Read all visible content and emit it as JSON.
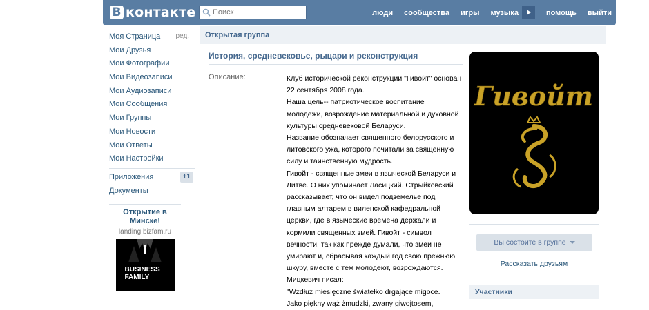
{
  "header": {
    "logo_letter": "В",
    "logo_text": "контакте",
    "search_placeholder": "Поиск",
    "nav": [
      "люди",
      "сообщества",
      "игры",
      "музыка",
      "помощь",
      "выйти"
    ]
  },
  "sidebar": {
    "items": [
      {
        "label": "Моя Страница",
        "extra": "ред."
      },
      {
        "label": "Мои Друзья"
      },
      {
        "label": "Мои Фотографии"
      },
      {
        "label": "Мои Видеозаписи"
      },
      {
        "label": "Мои Аудиозаписи"
      },
      {
        "label": "Мои Сообщения"
      },
      {
        "label": "Мои Группы"
      },
      {
        "label": "Мои Новости"
      },
      {
        "label": "Мои Ответы"
      },
      {
        "label": "Мои Настройки"
      }
    ],
    "apps_label": "Приложения",
    "apps_badge": "+1",
    "docs_label": "Документы"
  },
  "ad": {
    "title_line1": "Открытие в",
    "title_line2": "Минске!",
    "url": "landing.bizfam.ru",
    "image_line1": "BUSINESS",
    "image_line2": "FAMILY"
  },
  "group": {
    "type": "Открытая группа",
    "title": "История, средневековье, рыцари и реконструкция",
    "description_label": "Описание:",
    "description_lines": [
      "Клуб исторической реконструкции \"Гивойт\" основан",
      "22 сентября 2008 года.",
      "Наша цель-- патриотическое воспитание",
      "молодёжи, возрождение материальной и духовной",
      "культуры средневековой Беларуси.",
      "Название обозначает священного белорусского и",
      "литовского ужа, которого почитали за священную",
      "силу и таинственную мудрость.",
      "Гивойт - священные змеи в языческой Беларуси и",
      "Литве. О них упоминает Ласицкий. Стрыйковский",
      "рассказывает, что он видел подземелье под",
      "главным алтарем в виленской кафедральной",
      "церкви, где в языческие времена держали и",
      "кормили священных змей. Гивойт - символ",
      "вечности, так как прежде думали, что змеи не",
      "умирают и, сбрасывая каждый год свою прежнюю",
      "шкуру, вместе с тем молодеют, возрождаются.",
      "Мицкевич писал:",
      "\"Wzdłuż miesięczne światełko drgające migoce.",
      "Jako piękny wąż żmudzki, zwany giwojtosem,"
    ],
    "avatar_text": "Гивойт",
    "member_button": "Вы состоите в группе",
    "share_link": "Рассказать друзьям",
    "participants_label": "Участники"
  },
  "colors": {
    "header_bg": "#597da3",
    "link": "#2b587a",
    "group_title": "#45688e",
    "gold": "#c9a227"
  }
}
